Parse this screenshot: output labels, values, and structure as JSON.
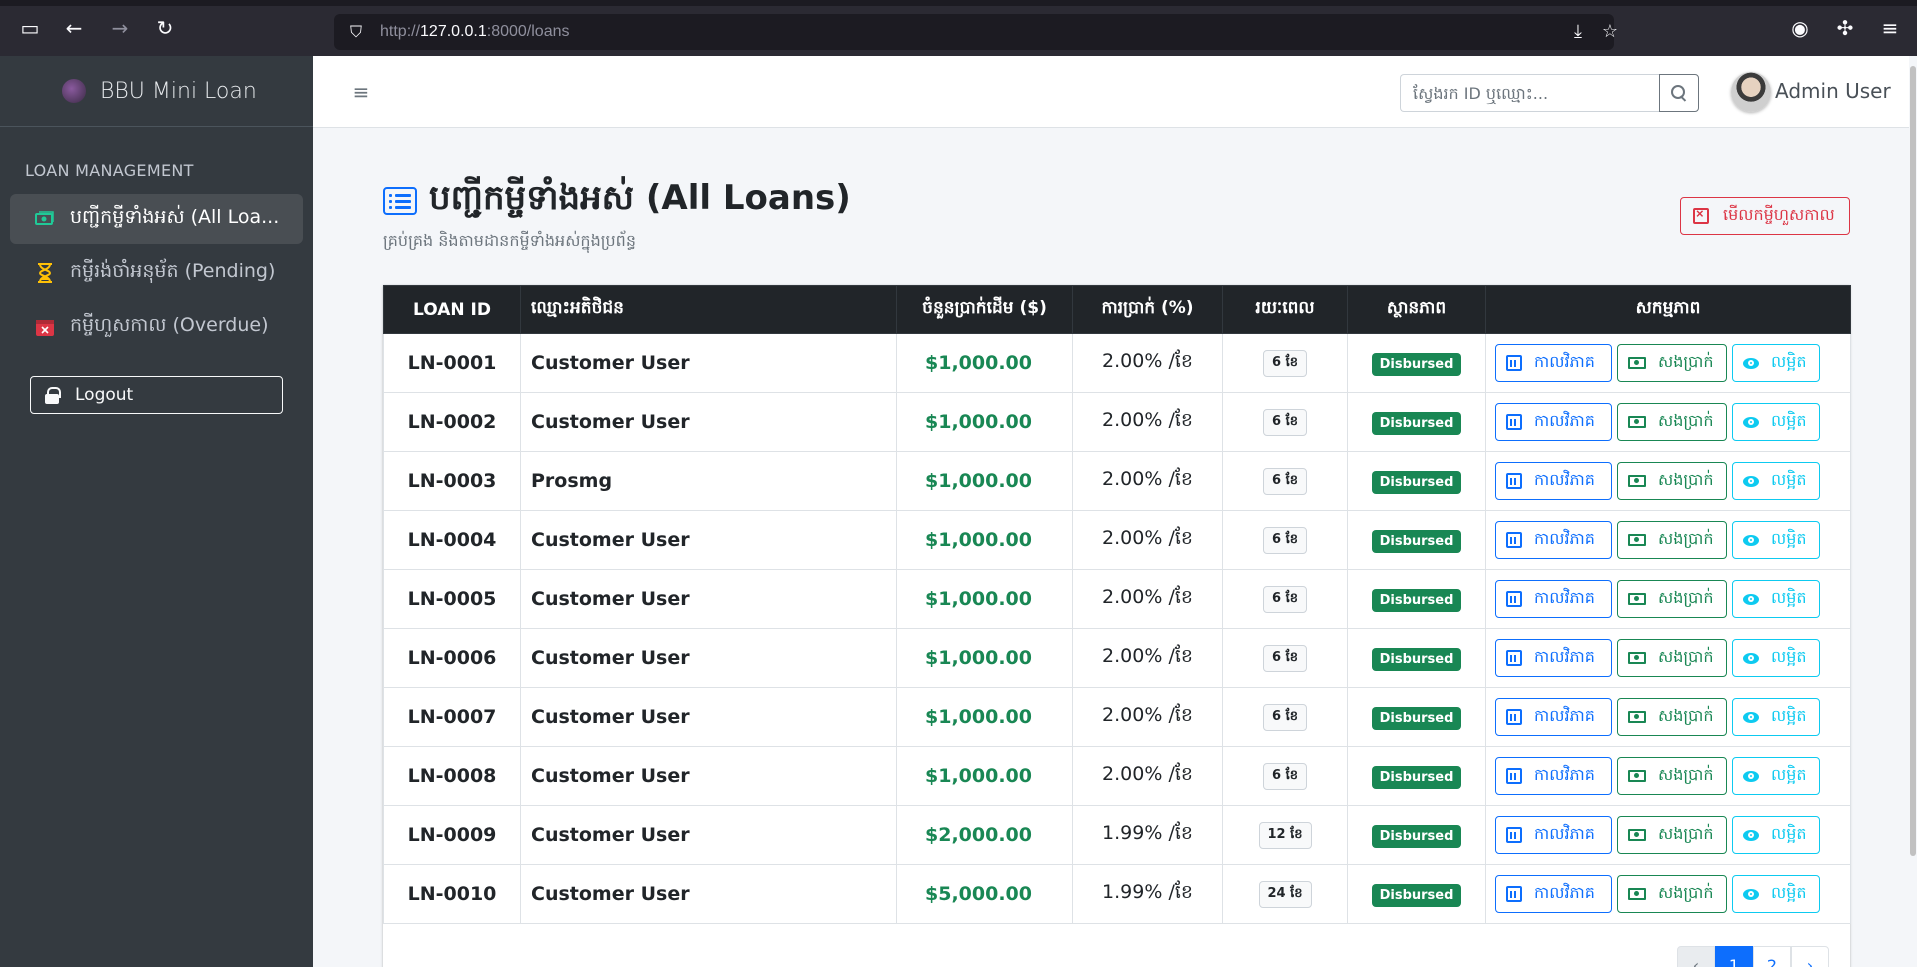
{
  "browser": {
    "url_prefix": "http://",
    "url_host": "127.0.0.1",
    "url_rest": ":8000/loans"
  },
  "sidebar": {
    "brand": "BBU Mini Loan",
    "section_header": "LOAN MANAGEMENT",
    "items": [
      {
        "label": "បញ្ជីកម្ចីទាំងអស់ (All Loa...",
        "icon": "cash-stack-icon",
        "color": "#20c997"
      },
      {
        "label": "កម្ចីរង់ចាំអនុម័ត (Pending)",
        "icon": "hourglass-icon",
        "color": "#ffc107"
      },
      {
        "label": "កម្ចីហួសកាល (Overdue)",
        "icon": "calendar-x-icon",
        "color": "#dc3545"
      }
    ],
    "logout": "Logout"
  },
  "topnav": {
    "search_placeholder": "ស្វែងរក ID ឬឈ្មោះ...",
    "user_name": "Admin User"
  },
  "page": {
    "title": "បញ្ជីកម្ចីទាំងអស់ (All Loans)",
    "subtitle": "គ្រប់គ្រង និងតាមដានកម្ចីទាំងអស់ក្នុងប្រព័ន្ធ",
    "overdue_button": "មើលកម្ចីហួសកាល"
  },
  "table": {
    "headers": [
      "LOAN ID",
      "ឈ្មោះអតិថិជន",
      "ចំនួនប្រាក់ដើម ($)",
      "ការប្រាក់ (%)",
      "រយៈពេល",
      "ស្ថានភាព",
      "សកម្មភាព"
    ],
    "action_labels": {
      "schedule": "កាលវិភាគ",
      "repay": "សងប្រាក់",
      "view": "លម្អិត"
    },
    "rows": [
      {
        "id": "LN-0001",
        "name": "Customer User",
        "amount": "$1,000.00",
        "rate": "2.00% /ខែ",
        "term": "6 ខែ",
        "status": "Disbursed"
      },
      {
        "id": "LN-0002",
        "name": "Customer User",
        "amount": "$1,000.00",
        "rate": "2.00% /ខែ",
        "term": "6 ខែ",
        "status": "Disbursed"
      },
      {
        "id": "LN-0003",
        "name": "Prosmg",
        "amount": "$1,000.00",
        "rate": "2.00% /ខែ",
        "term": "6 ខែ",
        "status": "Disbursed"
      },
      {
        "id": "LN-0004",
        "name": "Customer User",
        "amount": "$1,000.00",
        "rate": "2.00% /ខែ",
        "term": "6 ខែ",
        "status": "Disbursed"
      },
      {
        "id": "LN-0005",
        "name": "Customer User",
        "amount": "$1,000.00",
        "rate": "2.00% /ខែ",
        "term": "6 ខែ",
        "status": "Disbursed"
      },
      {
        "id": "LN-0006",
        "name": "Customer User",
        "amount": "$1,000.00",
        "rate": "2.00% /ខែ",
        "term": "6 ខែ",
        "status": "Disbursed"
      },
      {
        "id": "LN-0007",
        "name": "Customer User",
        "amount": "$1,000.00",
        "rate": "2.00% /ខែ",
        "term": "6 ខែ",
        "status": "Disbursed"
      },
      {
        "id": "LN-0008",
        "name": "Customer User",
        "amount": "$1,000.00",
        "rate": "2.00% /ខែ",
        "term": "6 ខែ",
        "status": "Disbursed"
      },
      {
        "id": "LN-0009",
        "name": "Customer User",
        "amount": "$2,000.00",
        "rate": "1.99% /ខែ",
        "term": "12 ខែ",
        "status": "Disbursed"
      },
      {
        "id": "LN-0010",
        "name": "Customer User",
        "amount": "$5,000.00",
        "rate": "1.99% /ខែ",
        "term": "24 ខែ",
        "status": "Disbursed"
      }
    ]
  },
  "pagination": {
    "prev": "‹",
    "pages": [
      "1",
      "2"
    ],
    "next": "›",
    "active": "1"
  },
  "colors": {
    "primary": "#0d6efd",
    "success": "#198754",
    "info": "#0dcaf0",
    "danger": "#dc3545",
    "sidebar_bg": "#343a40"
  }
}
